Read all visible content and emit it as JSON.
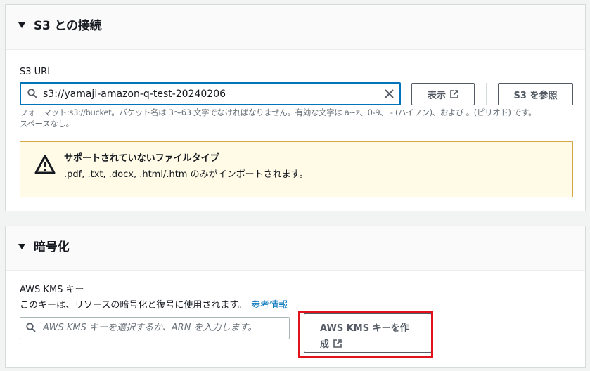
{
  "s3_section": {
    "title": "S3 との接続",
    "uri_label": "S3 URI",
    "uri_value": "s3://yamaji-amazon-q-test-20240206",
    "view_button": "表示",
    "browse_button": "S3 を参照",
    "hint_line1": "フォーマット:s3://bucket。バケット名は 3〜63 文字でなければなりません。有効な文字は a~z、0-9、 - (ハイフン)、および 。(ピリオド) です。",
    "hint_line2": "スペースなし。",
    "alert": {
      "title": "サポートされていないファイルタイプ",
      "body": ".pdf, .txt, .docx, .html/.htm のみがインポートされます。"
    }
  },
  "encryption_section": {
    "title": "暗号化",
    "kms_label": "AWS KMS キー",
    "description": "このキーは、リソースの暗号化と復号に使用されます。",
    "info_link": "参考情報",
    "kms_placeholder": "AWS KMS キーを選択するか、ARN を入力します。",
    "create_button_line1": "AWS KMS キーを作",
    "create_button_line2": "成"
  },
  "colors": {
    "focus_border": "#0073bb",
    "link": "#0073bb",
    "warning_bg": "#fffbe7",
    "warning_border": "#d5a54a",
    "highlight": "#e0121b"
  },
  "icons": [
    "caret-down-icon",
    "search-icon",
    "clear-icon",
    "external-link-icon",
    "warning-icon"
  ]
}
